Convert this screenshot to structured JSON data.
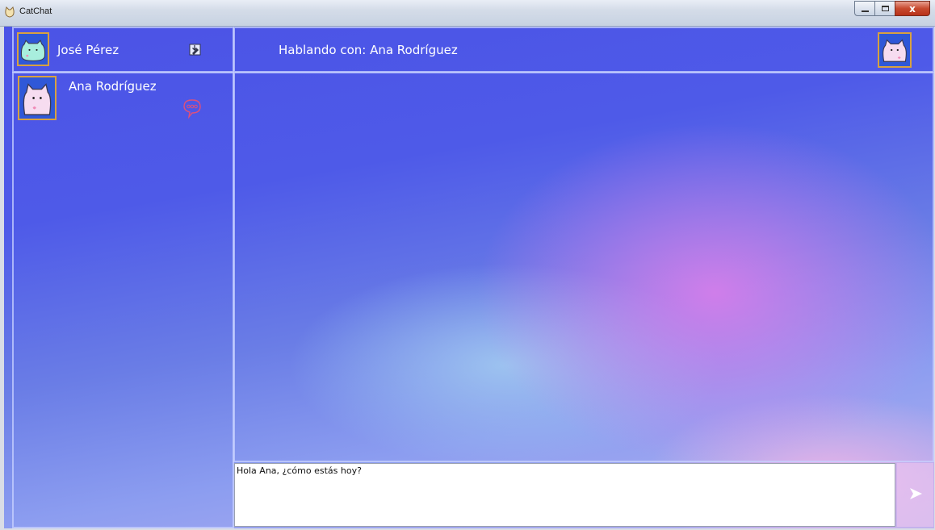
{
  "window": {
    "title": "CatChat",
    "close_glyph": "x"
  },
  "user": {
    "name": "José Pérez"
  },
  "contacts": [
    {
      "name": "Ana Rodríguez"
    }
  ],
  "chat_header": {
    "title": "Hablando con: Ana Rodríguez"
  },
  "composer": {
    "message": "Hola Ana, ¿cómo estás hoy?"
  },
  "icons": {
    "app": "cat-app-icon",
    "user_avatar": "cat-avatar-icon",
    "edit_profile": "edit-profile-icon",
    "contact_avatar": "cat-avatar-icon",
    "chat_bubble": "chat-bubble-icon",
    "send": "send-arrow-icon"
  },
  "colors": {
    "primary_blue": "#4b53e6",
    "accent_pink": "#e07dea",
    "border": "#c8d2ff",
    "avatar_frame": "#d8a140"
  }
}
